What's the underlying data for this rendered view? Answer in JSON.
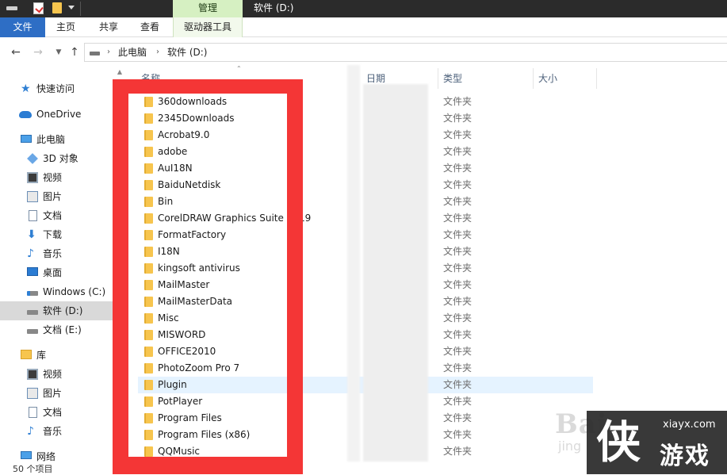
{
  "window": {
    "title": "软件 (D:)",
    "context_tab": "管理"
  },
  "ribbon": {
    "tabs": [
      "文件",
      "主页",
      "共享",
      "查看"
    ],
    "context_tool": "驱动器工具"
  },
  "address": {
    "crumbs": [
      "此电脑",
      "软件 (D:)"
    ]
  },
  "nav": {
    "quick_access": "快速访问",
    "onedrive": "OneDrive",
    "this_pc": "此电脑",
    "this_pc_items": [
      "3D 对象",
      "视频",
      "图片",
      "文档",
      "下载",
      "音乐",
      "桌面",
      "Windows (C:)",
      "软件 (D:)",
      "文档 (E:)"
    ],
    "library": "库",
    "library_items": [
      "视频",
      "图片",
      "文档",
      "音乐"
    ],
    "network": "网络"
  },
  "status": {
    "count_text": "50 个项目"
  },
  "columns": {
    "name": "名称",
    "date": "日期",
    "type": "类型",
    "size": "大小"
  },
  "files": [
    {
      "name": "360downloads",
      "type": "文件夹"
    },
    {
      "name": "2345Downloads",
      "type": "文件夹"
    },
    {
      "name": "Acrobat9.0",
      "type": "文件夹"
    },
    {
      "name": "adobe",
      "type": "文件夹"
    },
    {
      "name": "AuI18N",
      "type": "文件夹"
    },
    {
      "name": "BaiduNetdisk",
      "type": "文件夹"
    },
    {
      "name": "Bin",
      "type": "文件夹"
    },
    {
      "name": "CorelDRAW Graphics Suite 2019",
      "type": "文件夹"
    },
    {
      "name": "FormatFactory",
      "type": "文件夹"
    },
    {
      "name": "I18N",
      "type": "文件夹"
    },
    {
      "name": "kingsoft antivirus",
      "type": "文件夹"
    },
    {
      "name": "MailMaster",
      "type": "文件夹"
    },
    {
      "name": "MailMasterData",
      "type": "文件夹"
    },
    {
      "name": "Misc",
      "type": "文件夹"
    },
    {
      "name": "MISWORD",
      "type": "文件夹"
    },
    {
      "name": "OFFICE2010",
      "type": "文件夹"
    },
    {
      "name": "PhotoZoom Pro 7",
      "type": "文件夹"
    },
    {
      "name": "Plugin",
      "type": "文件夹"
    },
    {
      "name": "PotPlayer",
      "type": "文件夹"
    },
    {
      "name": "Program Files",
      "type": "文件夹"
    },
    {
      "name": "Program Files (x86)",
      "type": "文件夹"
    },
    {
      "name": "QQMusic",
      "type": "文件夹"
    }
  ],
  "watermark": {
    "baidu": "Bai",
    "baidu_sub": "jing",
    "logo": "侠",
    "site": "xiayx.com",
    "name": "游戏"
  },
  "colors": {
    "accent": "#2e6ec5",
    "context_tab": "#d6f0c2",
    "highlight": "#f43636",
    "hover_row": "#e5f3ff"
  }
}
